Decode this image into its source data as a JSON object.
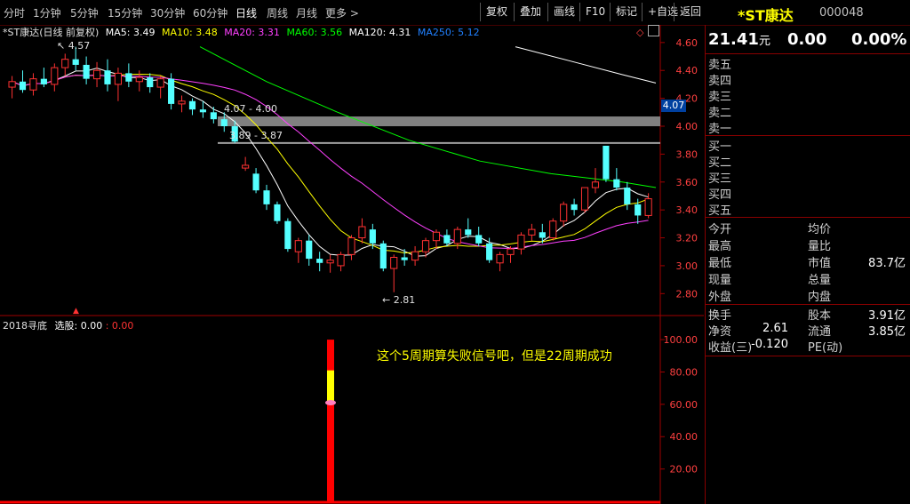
{
  "toolbar": {
    "timeframes": [
      "分时",
      "1分钟",
      "5分钟",
      "15分钟",
      "30分钟",
      "60分钟",
      "日线",
      "周线",
      "月线",
      "更多 >"
    ],
    "active_timeframe": "日线",
    "buttons": [
      "复权",
      "叠加",
      "画线",
      "F10",
      "标记",
      "+自选",
      "返回"
    ]
  },
  "stock": {
    "name": "*ST康达",
    "code": "000048",
    "price": "21.41",
    "price_unit": "元",
    "change": "0.00",
    "change_pct": "0.00%"
  },
  "main_chart": {
    "header_name": "*ST康达(日线 前复权)",
    "ma5": "MA5: 3.49",
    "ma10": "MA10: 3.48",
    "ma20": "MA20: 3.31",
    "ma60": "MA60: 3.56",
    "ma120": "MA120: 4.31",
    "ma250": "MA250: 5.12",
    "hl_label": "4.57",
    "low_label": "2.81",
    "zone1_label": "4.07 - 4.00",
    "zone2_label": "3.89 - 3.87",
    "current_price_tag": "4.07",
    "y_ticks": [
      "4.60",
      "4.40",
      "4.20",
      "4.00",
      "3.80",
      "3.60",
      "3.40",
      "3.20",
      "3.00",
      "2.80"
    ]
  },
  "sub_chart": {
    "indicator": "2018寻底",
    "field": "选股: 0.00",
    "value_red": ": 0.00",
    "note": "这个5周期算失败信号吧，但是22周期成功",
    "y_ticks": [
      "100.00",
      "80.00",
      "60.00",
      "40.00",
      "20.00"
    ]
  },
  "order_book": {
    "sell": [
      "卖五",
      "卖四",
      "卖三",
      "卖二",
      "卖一"
    ],
    "buy": [
      "买一",
      "买二",
      "买三",
      "买四",
      "买五"
    ]
  },
  "quote": {
    "left_labels": [
      "今开",
      "最高",
      "最低",
      "现量",
      "外盘"
    ],
    "right_labels": [
      "均价",
      "量比",
      "市值",
      "总量",
      "内盘"
    ],
    "market_cap": "83.7亿",
    "turnover_label": "换手",
    "share_cap_label": "股本",
    "share_cap": "3.91亿",
    "nav_label": "净资",
    "nav": "2.61",
    "float_label": "流通",
    "float_val": "3.85亿",
    "eps_label": "收益(三)",
    "eps": "-0.120",
    "pe_label": "PE(动)"
  },
  "colors": {
    "up": "#ff3232",
    "down": "#54ffff",
    "ma5": "#ffffff",
    "ma10": "#ffff00",
    "ma20": "#ff40ff",
    "ma60": "#00ff00",
    "ma120": "#ffffff",
    "ma250": "#2080ff"
  },
  "chart_data": {
    "type": "candlestick",
    "y_range": [
      2.7,
      4.65
    ],
    "candles": [
      [
        4.28,
        4.36,
        4.2,
        4.32
      ],
      [
        4.32,
        4.4,
        4.24,
        4.26
      ],
      [
        4.26,
        4.38,
        4.22,
        4.34
      ],
      [
        4.34,
        4.42,
        4.28,
        4.3
      ],
      [
        4.3,
        4.45,
        4.25,
        4.42
      ],
      [
        4.42,
        4.52,
        4.36,
        4.48
      ],
      [
        4.48,
        4.57,
        4.4,
        4.44
      ],
      [
        4.44,
        4.5,
        4.3,
        4.34
      ],
      [
        4.34,
        4.46,
        4.28,
        4.4
      ],
      [
        4.4,
        4.48,
        4.25,
        4.3
      ],
      [
        4.3,
        4.42,
        4.18,
        4.38
      ],
      [
        4.38,
        4.45,
        4.28,
        4.32
      ],
      [
        4.32,
        4.4,
        4.25,
        4.35
      ],
      [
        4.35,
        4.38,
        4.24,
        4.28
      ],
      [
        4.28,
        4.36,
        4.2,
        4.34
      ],
      [
        4.34,
        4.38,
        4.12,
        4.16
      ],
      [
        4.16,
        4.22,
        4.1,
        4.18
      ],
      [
        4.18,
        4.2,
        4.08,
        4.12
      ],
      [
        4.12,
        4.18,
        4.06,
        4.1
      ],
      [
        4.1,
        4.14,
        4.02,
        4.05
      ],
      [
        4.05,
        4.1,
        3.96,
        4.0
      ],
      [
        4.0,
        4.04,
        3.88,
        3.89
      ],
      [
        3.7,
        3.78,
        3.68,
        3.72
      ],
      [
        3.66,
        3.7,
        3.52,
        3.54
      ],
      [
        3.54,
        3.58,
        3.4,
        3.44
      ],
      [
        3.44,
        3.46,
        3.3,
        3.32
      ],
      [
        3.32,
        3.34,
        3.1,
        3.12
      ],
      [
        3.1,
        3.2,
        3.02,
        3.18
      ],
      [
        3.18,
        3.22,
        3.0,
        3.05
      ],
      [
        3.05,
        3.1,
        2.96,
        3.02
      ],
      [
        3.02,
        3.08,
        2.95,
        3.04
      ],
      [
        3.0,
        3.1,
        2.96,
        3.08
      ],
      [
        3.08,
        3.22,
        3.04,
        3.2
      ],
      [
        3.2,
        3.34,
        3.16,
        3.28
      ],
      [
        3.26,
        3.3,
        3.12,
        3.16
      ],
      [
        3.16,
        3.18,
        2.96,
        2.98
      ],
      [
        2.98,
        3.08,
        2.81,
        3.06
      ],
      [
        3.06,
        3.12,
        3.0,
        3.04
      ],
      [
        3.04,
        3.14,
        3.0,
        3.1
      ],
      [
        3.1,
        3.2,
        3.06,
        3.18
      ],
      [
        3.18,
        3.26,
        3.12,
        3.24
      ],
      [
        3.22,
        3.26,
        3.14,
        3.16
      ],
      [
        3.16,
        3.28,
        3.12,
        3.26
      ],
      [
        3.26,
        3.34,
        3.2,
        3.22
      ],
      [
        3.22,
        3.28,
        3.14,
        3.16
      ],
      [
        3.16,
        3.2,
        3.02,
        3.04
      ],
      [
        3.02,
        3.1,
        2.96,
        3.08
      ],
      [
        3.08,
        3.14,
        3.02,
        3.12
      ],
      [
        3.12,
        3.24,
        3.08,
        3.22
      ],
      [
        3.22,
        3.3,
        3.18,
        3.26
      ],
      [
        3.24,
        3.3,
        3.16,
        3.2
      ],
      [
        3.2,
        3.34,
        3.18,
        3.32
      ],
      [
        3.32,
        3.46,
        3.28,
        3.44
      ],
      [
        3.44,
        3.48,
        3.36,
        3.4
      ],
      [
        3.4,
        3.56,
        3.38,
        3.56
      ],
      [
        3.56,
        3.7,
        3.52,
        3.6
      ],
      [
        3.86,
        3.86,
        3.6,
        3.62
      ],
      [
        3.62,
        3.7,
        3.54,
        3.56
      ],
      [
        3.56,
        3.6,
        3.4,
        3.44
      ],
      [
        3.44,
        3.48,
        3.3,
        3.36
      ],
      [
        3.36,
        3.52,
        3.34,
        3.48
      ]
    ]
  }
}
